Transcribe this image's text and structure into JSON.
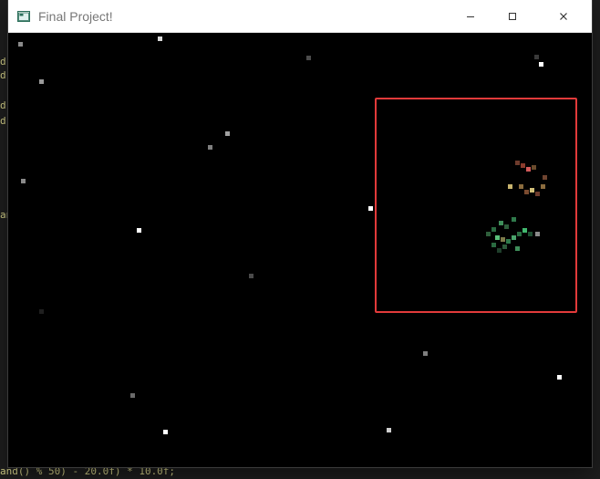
{
  "window": {
    "title": "Final Project!",
    "controls": {
      "minimize": "—",
      "maximize": "☐",
      "close": "✕"
    }
  },
  "background_code": [
    {
      "text": "d"
    },
    {
      "text": "d"
    },
    {
      "text": "d"
    },
    {
      "text": "d"
    },
    {
      "text": "an"
    },
    {
      "text": "and() % 50) - 20.0f) * 10.0f;"
    }
  ],
  "scene": {
    "selection_color": "#e23a3a"
  }
}
